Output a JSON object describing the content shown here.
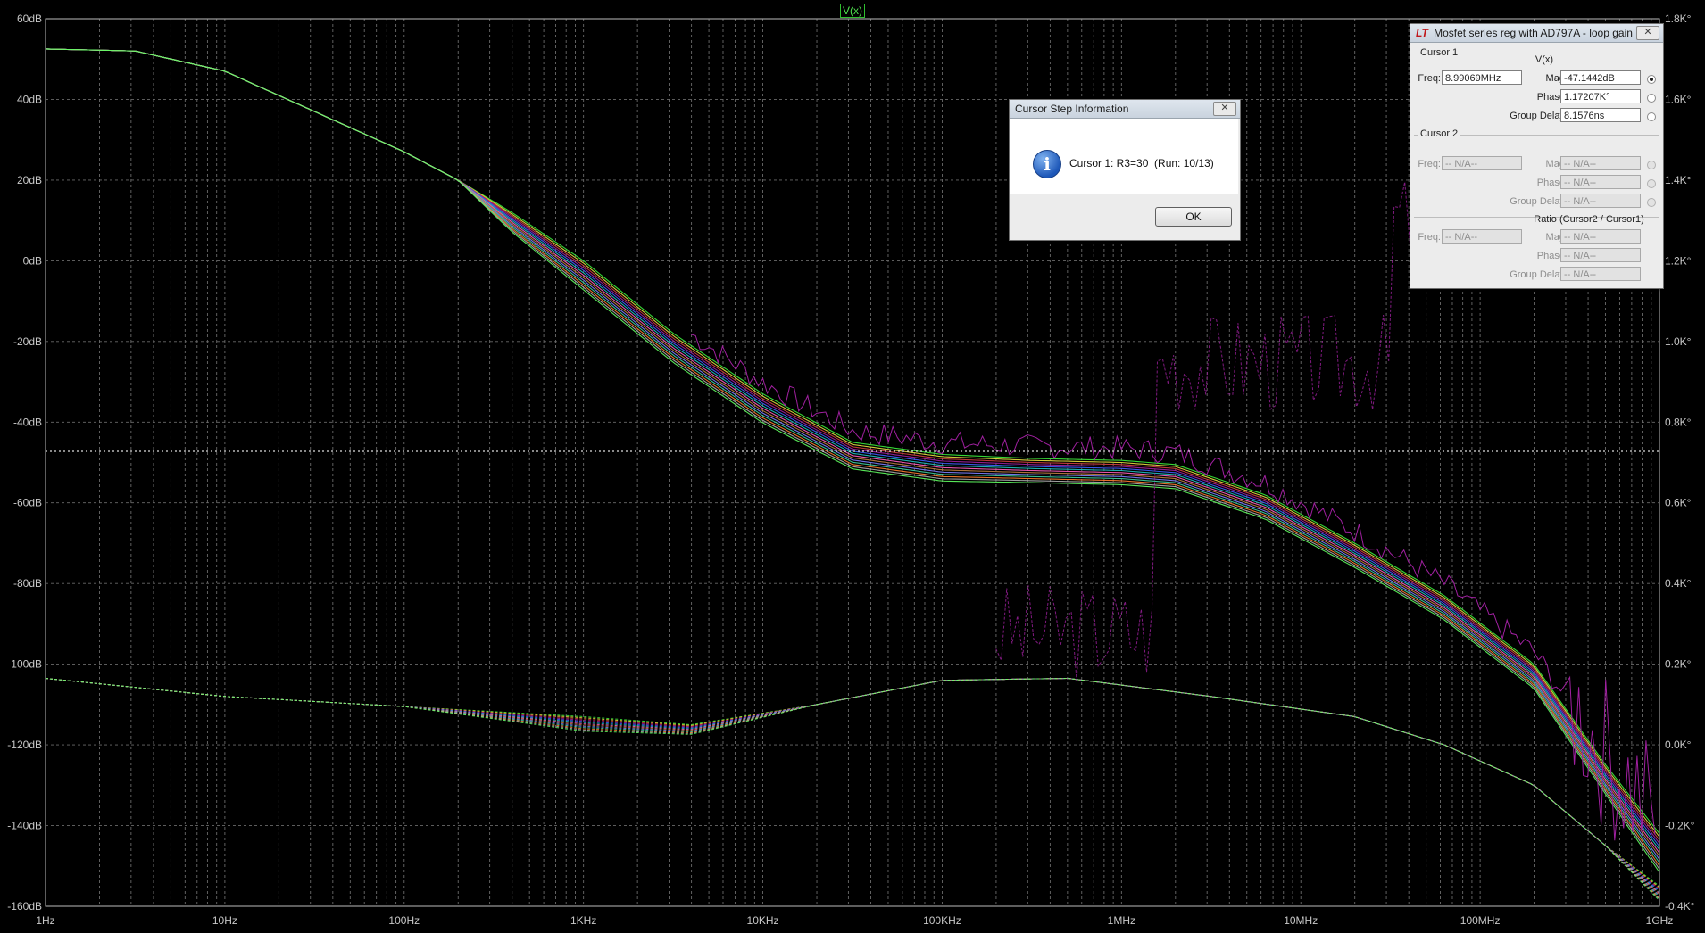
{
  "plot": {
    "trace_label": "V(x)",
    "left_axis_ticks": [
      "60dB",
      "40dB",
      "20dB",
      "0dB",
      "-20dB",
      "-40dB",
      "-60dB",
      "-80dB",
      "-100dB",
      "-120dB",
      "-140dB",
      "-160dB"
    ],
    "right_axis_ticks": [
      "1.8K°",
      "1.6K°",
      "1.4K°",
      "1.2K°",
      "1.0K°",
      "0.8K°",
      "0.6K°",
      "0.4K°",
      "0.2K°",
      "0.0K°",
      "-0.2K°",
      "-0.4K°"
    ],
    "x_axis_ticks": [
      "1Hz",
      "10Hz",
      "100Hz",
      "1KHz",
      "10KHz",
      "100KHz",
      "1MHz",
      "10MHz",
      "100MHz",
      "1GHz"
    ],
    "colors": {
      "background": "#000000",
      "grid": "#6a6a6a",
      "axis_text": "#c8c8c8",
      "cursor_line": "#dcdcdc",
      "trace_primary": "#3cf03c",
      "trace_phase": "#a020a0"
    }
  },
  "cursor_window": {
    "title": "Mosfet series reg with AD797A - loop gain",
    "cursor1": {
      "group_label": "Cursor 1",
      "column_header": "V(x)",
      "freq_label": "Freq:",
      "freq_value": "8.99069MHz",
      "mag_label": "Mag:",
      "mag_value": "-47.1442dB",
      "phase_label": "Phase:",
      "phase_value": "1.17207K°",
      "gd_label": "Group Delay:",
      "gd_value": "8.1576ns"
    },
    "cursor2": {
      "group_label": "Cursor 2",
      "freq_label": "Freq:",
      "freq_value": "-- N/A--",
      "mag_label": "Mag:",
      "mag_value": "-- N/A--",
      "phase_label": "Phase:",
      "phase_value": "-- N/A--",
      "gd_label": "Group Delay:",
      "gd_value": "-- N/A--"
    },
    "ratio": {
      "group_label": "Ratio (Cursor2 / Cursor1)",
      "freq_label": "Freq:",
      "freq_value": "-- N/A--",
      "mag_label": "Mag:",
      "mag_value": "-- N/A--",
      "phase_label": "Phase:",
      "phase_value": "-- N/A--",
      "gd_label": "Group Delay:",
      "gd_value": "-- N/A--"
    }
  },
  "step_dialog": {
    "title": "Cursor Step Information",
    "message": "Cursor 1: R3=30  (Run: 10/13)",
    "ok_label": "OK",
    "close_glyph": "✕"
  }
}
